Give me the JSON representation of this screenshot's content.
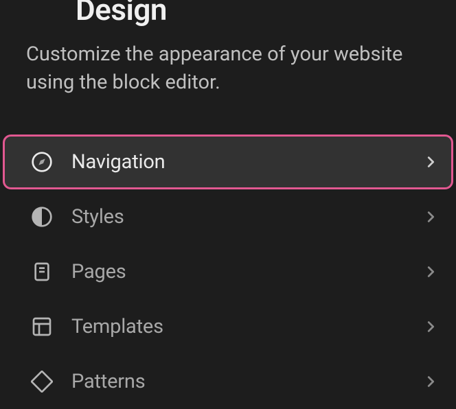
{
  "header": {
    "title": "Design",
    "subtitle": "Customize the appearance of your website using the block editor."
  },
  "menu": {
    "items": [
      {
        "label": "Navigation"
      },
      {
        "label": "Styles"
      },
      {
        "label": "Pages"
      },
      {
        "label": "Templates"
      },
      {
        "label": "Patterns"
      }
    ]
  },
  "colors": {
    "accent": "#e25891",
    "background": "#1d1d1d",
    "selected_bg": "#323232"
  }
}
